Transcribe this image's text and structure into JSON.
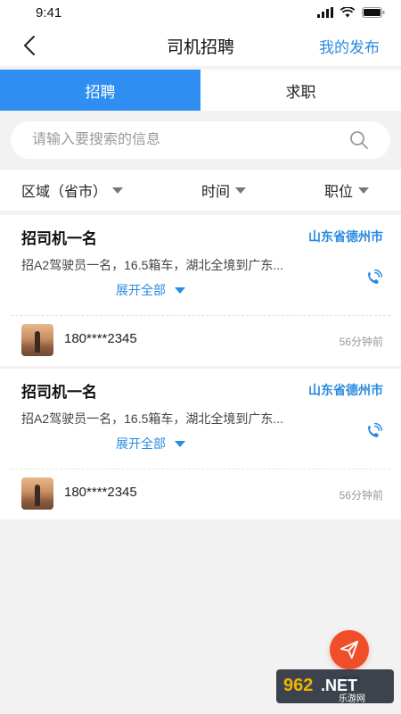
{
  "status_bar": {
    "time": "9:41"
  },
  "header": {
    "title": "司机招聘",
    "action": "我的发布"
  },
  "tabs": [
    {
      "label": "招聘",
      "active": true
    },
    {
      "label": "求职",
      "active": false
    }
  ],
  "search": {
    "placeholder": "请输入要搜索的信息",
    "value": ""
  },
  "filters": [
    {
      "label": "区域（省市）"
    },
    {
      "label": "时间"
    },
    {
      "label": "职位"
    }
  ],
  "listings": [
    {
      "title": "招司机一名",
      "location": "山东省德州市",
      "description": "招A2驾驶员一名，16.5箱车，湖北全境到广东...",
      "expand_label": "展开全部",
      "contact": "180****2345",
      "time": "56分钟前"
    },
    {
      "title": "招司机一名",
      "location": "山东省德州市",
      "description": "招A2驾驶员一名，16.5箱车，湖北全境到广东...",
      "expand_label": "展开全部",
      "contact": "180****2345",
      "time": "56分钟前"
    }
  ],
  "fab": {
    "label": "发布"
  },
  "watermark": {
    "text": "962.NET",
    "subtext": "乐游网"
  },
  "colors": {
    "accent": "#2f8ef2",
    "link": "#2a8be0",
    "fab": "#f04e2a"
  }
}
